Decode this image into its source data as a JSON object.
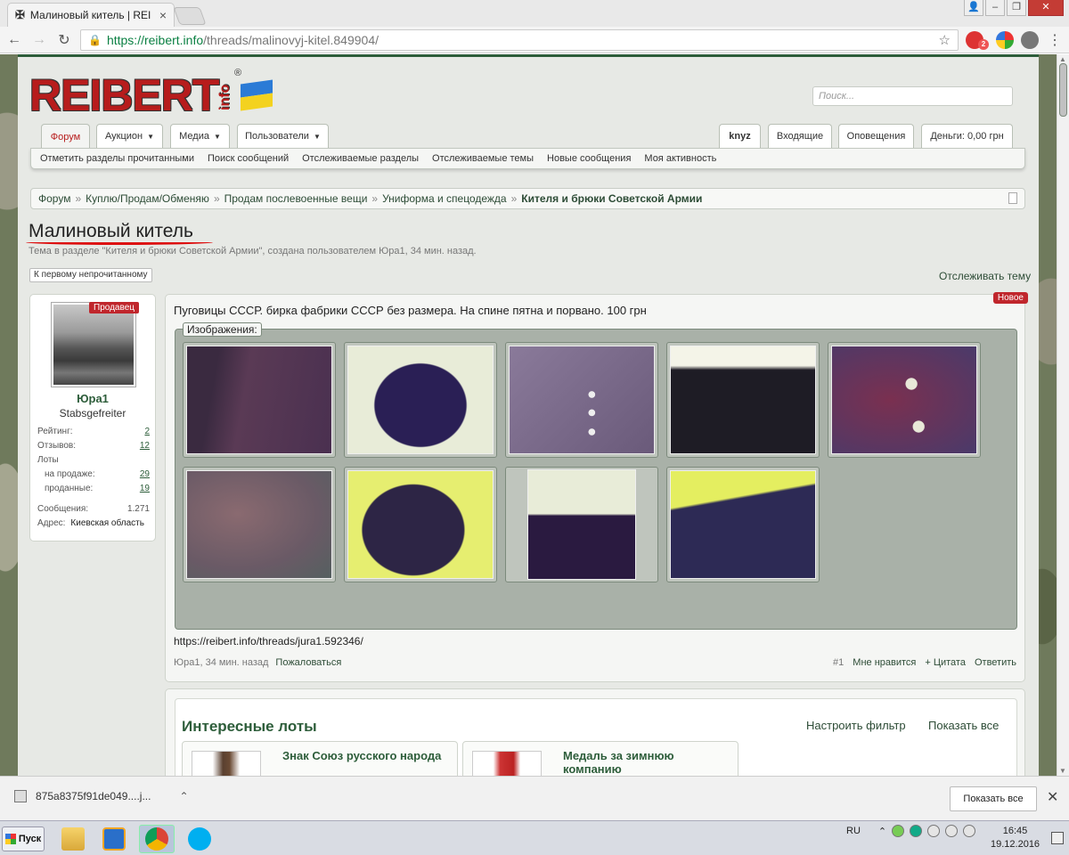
{
  "browser": {
    "tab_title": "Малиновый китель | REI",
    "url_host": "https://reibert.info",
    "url_path": "/threads/malinovyj-kitel.849904/",
    "ext_badge": "2"
  },
  "site": {
    "logo": "REIBERT",
    "logo_info": "info",
    "logo_reg": "®",
    "search_placeholder": "Поиск...",
    "nav_left": [
      {
        "label": "Форум"
      },
      {
        "label": "Аукцион"
      },
      {
        "label": "Медиа"
      },
      {
        "label": "Пользователи"
      }
    ],
    "nav_right": [
      {
        "label": "knyz"
      },
      {
        "label": "Входящие"
      },
      {
        "label": "Оповещения"
      },
      {
        "label": "Деньги: 0,00 грн"
      }
    ],
    "subnav": [
      "Отметить разделы прочитанными",
      "Поиск сообщений",
      "Отслеживаемые разделы",
      "Отслеживаемые темы",
      "Новые сообщения",
      "Моя активность"
    ]
  },
  "breadcrumb": [
    "Форум",
    "Куплю/Продам/Обменяю",
    "Продам послевоенные вещи",
    "Униформа и спецодежда",
    "Кителя и брюки Советской Армии"
  ],
  "thread": {
    "title": "Малиновый китель",
    "description": "Тема в разделе \"Кителя и брюки Советской Армии\", создана пользователем Юра1, 34 мин. назад.",
    "first_unread": "К первому непрочитанному",
    "watch": "Отслеживать тему"
  },
  "user": {
    "badge": "Продавец",
    "name": "Юра1",
    "rank": "Stabsgefreiter",
    "stats": [
      {
        "label": "Рейтинг:",
        "value": "2"
      },
      {
        "label": "Отзывов:",
        "value": "12"
      },
      {
        "label": "Лоты",
        "value": ""
      },
      {
        "label": "на продаже:",
        "value": "29"
      },
      {
        "label": "проданные:",
        "value": "19"
      },
      {
        "label": "Сообщения:",
        "value": "1.271"
      },
      {
        "label": "Адрес:",
        "value": "Киевская область"
      }
    ]
  },
  "post": {
    "new_badge": "Новое",
    "text": "Пуговицы СССР. бирка фабрики СССР без размера. На спине пятна и порвано. 100 грн",
    "images_label": "Изображения:",
    "images": [
      {
        "kind": "tape-dark",
        "color": "#5a3a55"
      },
      {
        "kind": "jacket",
        "color": "#2a1f55"
      },
      {
        "kind": "buttons",
        "color": "#6a5a7a"
      },
      {
        "kind": "collar",
        "color": "#1e1c25"
      },
      {
        "kind": "buttons-close",
        "color": "#4a3a6a"
      },
      {
        "kind": "fabric",
        "color": "#6a5a66"
      },
      {
        "kind": "jacket-yellow",
        "color": "#2d2545"
      },
      {
        "kind": "sleeve",
        "color": "#2a1a40"
      },
      {
        "kind": "tape-yellow",
        "color": "#2d2a55"
      }
    ],
    "link": "https://reibert.info/threads/jura1.592346/",
    "author_time": "Юра1, 34 мин. назад",
    "report": "Пожаловаться",
    "number": "#1",
    "like": "Мне нравится",
    "quote": "+ Цитата",
    "reply": "Ответить"
  },
  "lots": {
    "title": "Интересные лоты",
    "filter": "Настроить фильтр",
    "show_all": "Показать все",
    "items": [
      {
        "name": "Знак Союз русского народа"
      },
      {
        "name": "Медаль за зимнюю компанию"
      }
    ]
  },
  "downloads": {
    "file": "875a8375f91de049....j...",
    "show_all": "Показать все"
  },
  "taskbar": {
    "start": "Пуск",
    "lang": "RU",
    "time": "16:45",
    "date": "19.12.2016"
  }
}
